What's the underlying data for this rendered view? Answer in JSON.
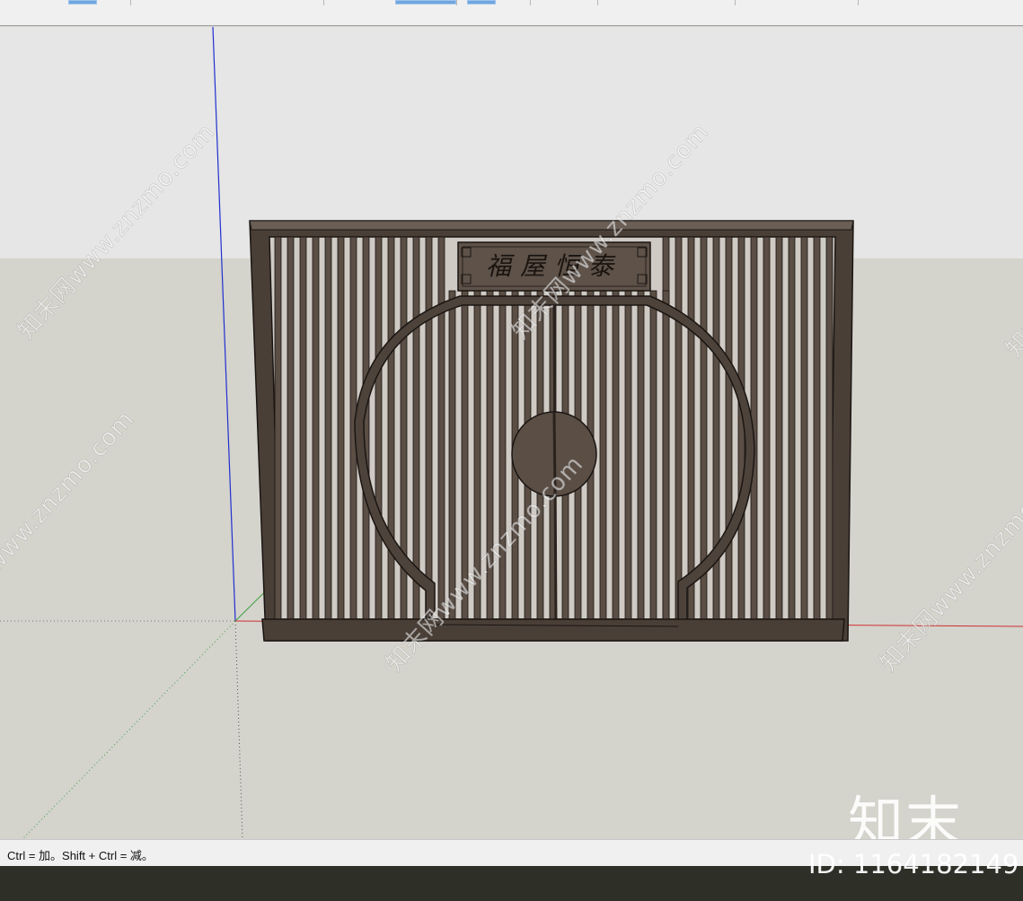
{
  "status": {
    "hint": "Ctrl = 加。Shift + Ctrl = 减。"
  },
  "watermark": {
    "site": "知末网www.znzmo.com",
    "logo": "知末",
    "id": "ID: 1164182149"
  },
  "model": {
    "plaque_text": "福屋恒泰",
    "frame_color": "#4a3f37",
    "panel_color": "#5a4e45"
  },
  "colors": {
    "sky": "#e4e6e5",
    "ground": "#d4d3cc",
    "axis_red": "#d03030",
    "axis_green": "#40a040",
    "axis_blue": "#2030d0"
  }
}
